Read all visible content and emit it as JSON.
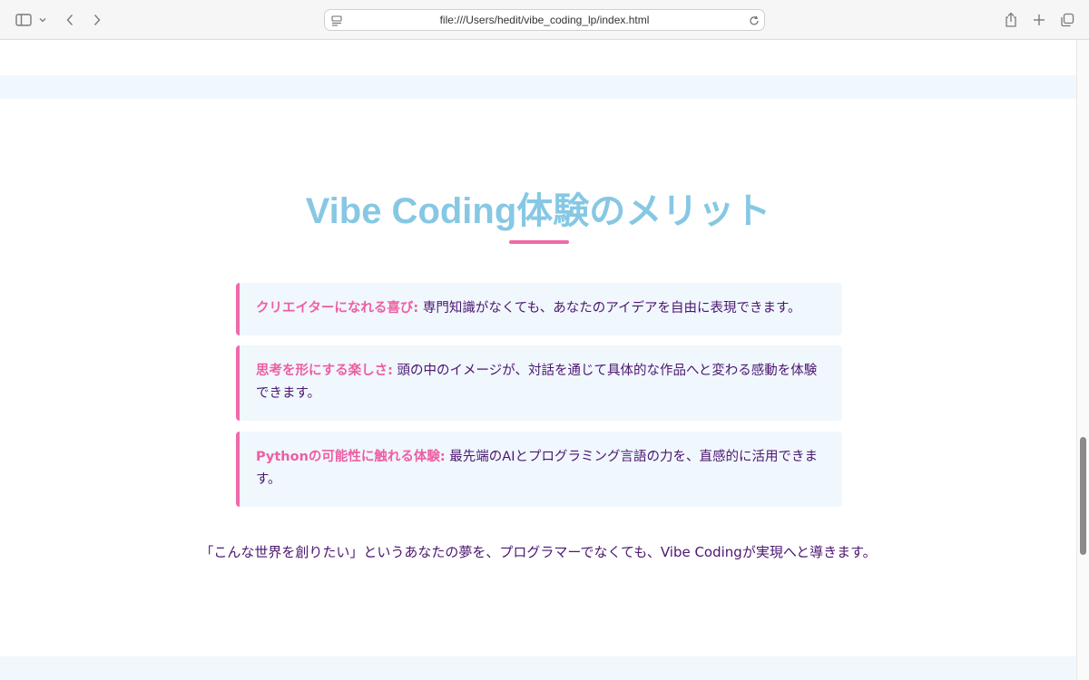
{
  "browser": {
    "url": "file:///Users/hedit/vibe_coding_lp/index.html"
  },
  "icons": {
    "sidebar": "sidebar-icon",
    "chevron": "chevron-down-icon",
    "back": "chevron-left-icon",
    "forward": "chevron-right-icon",
    "page": "page-icon",
    "reload": "reload-icon",
    "share": "share-icon",
    "new_tab": "plus-icon",
    "tabs": "tabs-overview-icon"
  },
  "colors": {
    "title": "#86c8e4",
    "accent_pink": "#ee6aa9",
    "text_purple": "#4b1670",
    "card_background": "#f0f7fd"
  },
  "section": {
    "title": "Vibe Coding体験のメリット",
    "cards": [
      {
        "label": "クリエイターになれる喜び:",
        "text": " 専門知識がなくても、あなたのアイデアを自由に表現できます。"
      },
      {
        "label": "思考を形にする楽しさ:",
        "text": " 頭の中のイメージが、対話を通じて具体的な作品へと変わる感動を体験できます。"
      },
      {
        "label": "Pythonの可能性に触れる体験:",
        "text": " 最先端のAIとプログラミング言語の力を、直感的に活用できます。"
      }
    ],
    "closing": "「こんな世界を創りたい」というあなたの夢を、プログラマーでなくても、Vibe Codingが実現へと導きます。"
  }
}
